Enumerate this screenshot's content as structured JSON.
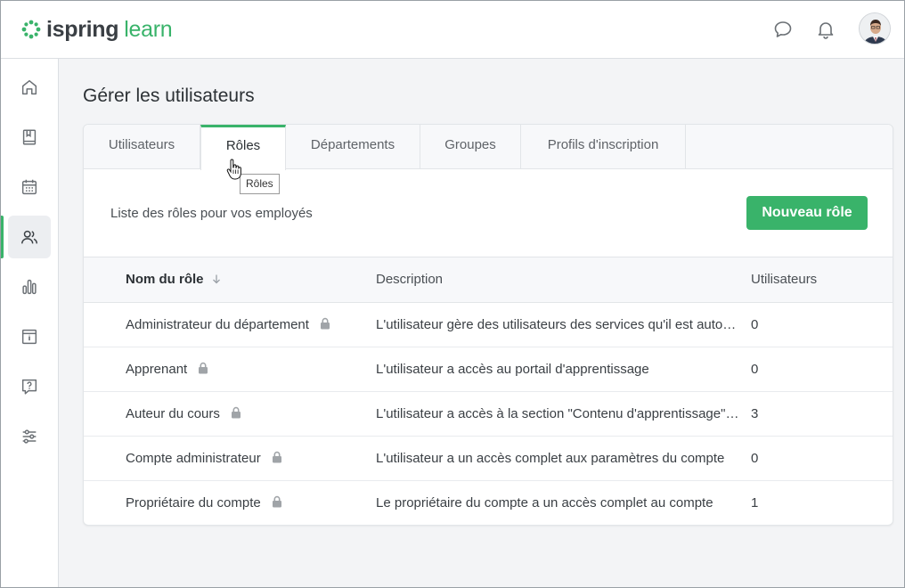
{
  "app": {
    "logo_part1": "ispring",
    "logo_part2": "learn",
    "brand_color": "#39b36a"
  },
  "header": {
    "icons": [
      "chat-icon",
      "bell-icon"
    ]
  },
  "sidebar": {
    "items": [
      {
        "name": "home-icon"
      },
      {
        "name": "book-icon"
      },
      {
        "name": "calendar-icon"
      },
      {
        "name": "users-icon",
        "active": true
      },
      {
        "name": "reports-icon"
      },
      {
        "name": "info-icon"
      },
      {
        "name": "help-icon"
      },
      {
        "name": "settings-icon"
      }
    ]
  },
  "page": {
    "title": "Gérer les utilisateurs",
    "tabs": [
      {
        "label": "Utilisateurs"
      },
      {
        "label": "Rôles",
        "active": true
      },
      {
        "label": "Départements"
      },
      {
        "label": "Groupes"
      },
      {
        "label": "Profils d'inscription"
      }
    ],
    "tooltip": "Rôles",
    "subtitle": "Liste des rôles pour vos employés",
    "new_button": "Nouveau rôle",
    "table": {
      "columns": [
        "Nom du rôle",
        "Description",
        "Utilisateurs"
      ],
      "rows": [
        {
          "name": "Administrateur du département",
          "description": "L'utilisateur gère des utilisateurs des services qu'il est autorisé à gérer",
          "users": "0"
        },
        {
          "name": "Apprenant",
          "description": "L'utilisateur a accès au portail d'apprentissage",
          "users": "0"
        },
        {
          "name": "Auteur du cours",
          "description": "L'utilisateur a accès à la section \"Contenu d'apprentissage\" ou similaire",
          "users": "3"
        },
        {
          "name": "Compte administrateur",
          "description": "L'utilisateur a un accès complet aux paramètres du compte",
          "users": "0"
        },
        {
          "name": "Propriétaire du compte",
          "description": "Le propriétaire du compte a un accès complet au compte",
          "users": "1"
        }
      ]
    }
  }
}
